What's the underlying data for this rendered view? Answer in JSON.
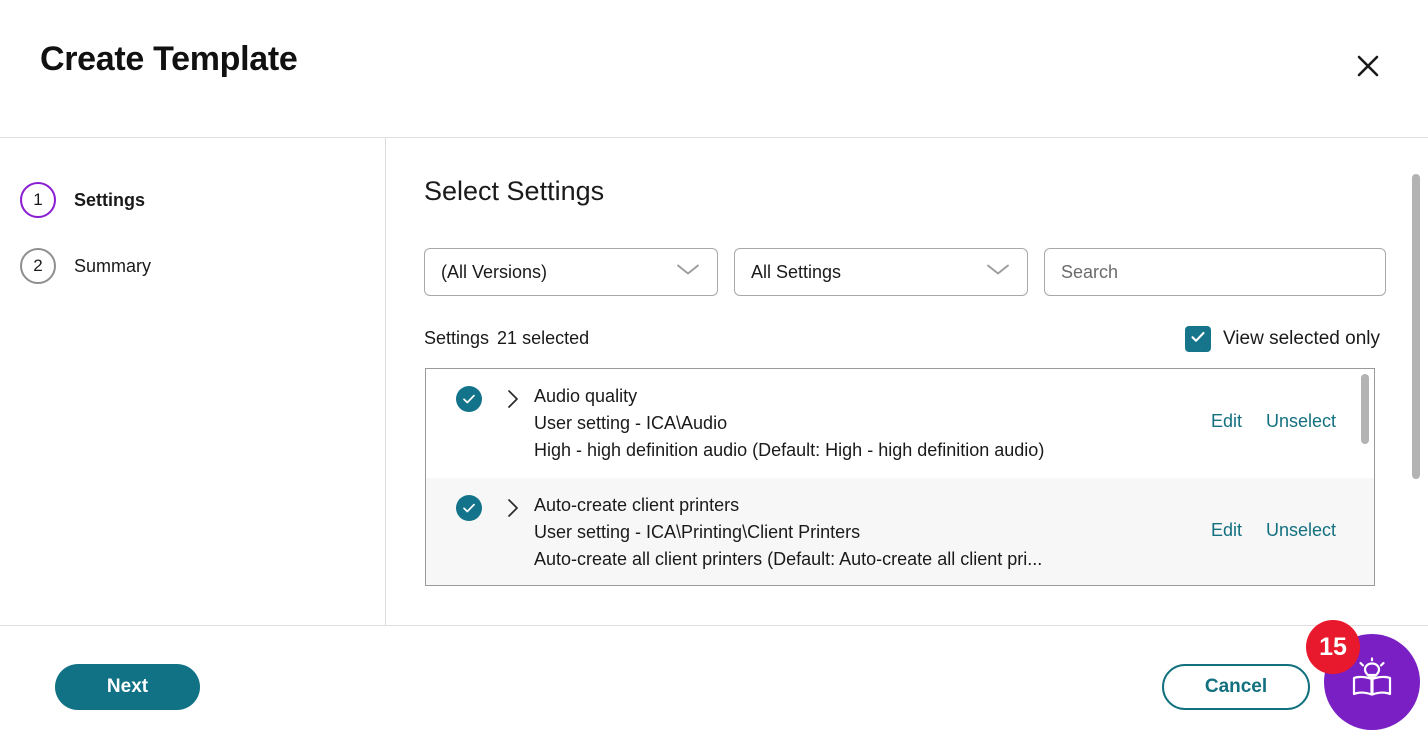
{
  "dialog": {
    "title": "Create Template",
    "close_icon": "close-icon"
  },
  "sidebar": {
    "steps": [
      {
        "number": "1",
        "label": "Settings",
        "state": "active"
      },
      {
        "number": "2",
        "label": "Summary",
        "state": "inactive"
      }
    ]
  },
  "main": {
    "title": "Select Settings",
    "filters": {
      "version": {
        "value": "(All Versions)",
        "chevron_icon": "chevron-down-icon"
      },
      "settings_type": {
        "value": "All Settings",
        "chevron_icon": "chevron-down-icon"
      },
      "search": {
        "value": "",
        "placeholder": "Search"
      }
    },
    "list_header": {
      "label": "Settings",
      "count": "21 selected",
      "view_selected_only": {
        "label": "View selected only",
        "checked": true,
        "check_icon": "check-icon"
      }
    },
    "settings": [
      {
        "selected": true,
        "check_icon": "check-circle-icon",
        "expand_icon": "chevron-right-icon",
        "title": "Audio quality",
        "path": "User setting - ICA\\Audio",
        "value": "High - high definition audio (Default: High - high definition audio)",
        "edit_label": "Edit",
        "unselect_label": "Unselect"
      },
      {
        "selected": true,
        "check_icon": "check-circle-icon",
        "expand_icon": "chevron-right-icon",
        "title": "Auto-create client printers",
        "path": "User setting - ICA\\Printing\\Client Printers",
        "value": "Auto-create all client printers (Default: Auto-create all client pri...",
        "edit_label": "Edit",
        "unselect_label": "Unselect"
      }
    ]
  },
  "footer": {
    "next_label": "Next",
    "cancel_label": "Cancel"
  },
  "help_widget": {
    "badge_count": "15",
    "icon": "book-lightbulb-icon"
  },
  "colors": {
    "teal": "#127285",
    "teal_link": "#12707F",
    "purple_active": "#8A1CD3",
    "purple_widget": "#7A1FC4",
    "badge_red": "#E8192C",
    "row_alt_bg": "#f7f7f7"
  }
}
